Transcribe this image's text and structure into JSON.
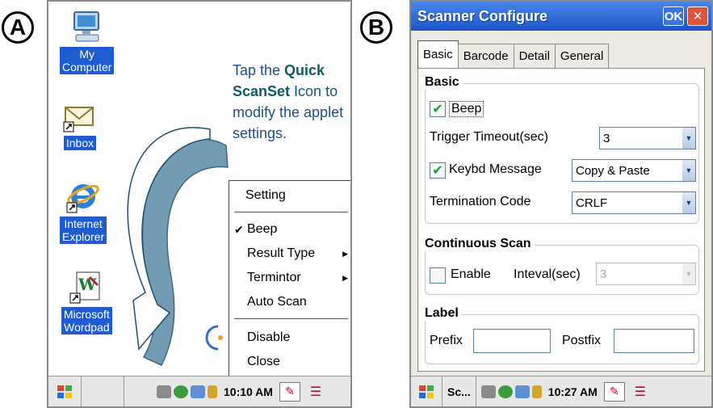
{
  "labels": {
    "a": "A",
    "b": "B"
  },
  "panel_a": {
    "desktop_icons": [
      {
        "label": "My\nComputer",
        "icon": "computer-icon"
      },
      {
        "label": "Inbox",
        "icon": "inbox-icon"
      },
      {
        "label": "Internet\nExplorer",
        "icon": "internet-explorer-icon"
      },
      {
        "label": "Microsoft\nWordpad",
        "icon": "wordpad-icon"
      }
    ],
    "tip": {
      "pre": "Tap the ",
      "bold": "Quick ScanSet",
      "post": " Icon to modify the applet settings."
    },
    "context_menu": {
      "header": "Setting",
      "items": [
        {
          "label": "Beep",
          "checked": true,
          "submenu": false
        },
        {
          "label": "Result Type",
          "checked": false,
          "submenu": true
        },
        {
          "label": "Termintor",
          "checked": false,
          "submenu": true
        },
        {
          "label": "Auto Scan",
          "checked": false,
          "submenu": false
        }
      ],
      "footer_items": [
        "Disable",
        "Close"
      ]
    },
    "taskbar": {
      "time": "10:10 AM"
    }
  },
  "panel_b": {
    "title": "Scanner Configure",
    "ok_label": "OK",
    "close_label": "✕",
    "tabs": [
      "Basic",
      "Barcode",
      "Detail",
      "General"
    ],
    "active_tab": "Basic",
    "basic": {
      "group_title": "Basic",
      "beep_label": "Beep",
      "beep_checked": true,
      "trigger_label": "Trigger Timeout(sec)",
      "trigger_value": "3",
      "keybd_label": "Keybd Message",
      "keybd_checked": true,
      "keybd_value": "Copy & Paste",
      "termination_label": "Termination Code",
      "termination_value": "CRLF"
    },
    "continuous": {
      "group_title": "Continuous Scan",
      "enable_label": "Enable",
      "enable_checked": false,
      "interval_label": "Inteval(sec)",
      "interval_value": "3"
    },
    "label_group": {
      "group_title": "Label",
      "prefix_label": "Prefix",
      "postfix_label": "Postfix",
      "prefix_value": "",
      "postfix_value": ""
    },
    "taskbar": {
      "app_label": "Sc...",
      "time": "10:27 AM"
    }
  },
  "colors": {
    "selection_blue": "#1f5bd1",
    "titlebar_blue": "#2a62d4",
    "tip_blue": "#1b4f8c",
    "close_red": "#e0533a"
  }
}
